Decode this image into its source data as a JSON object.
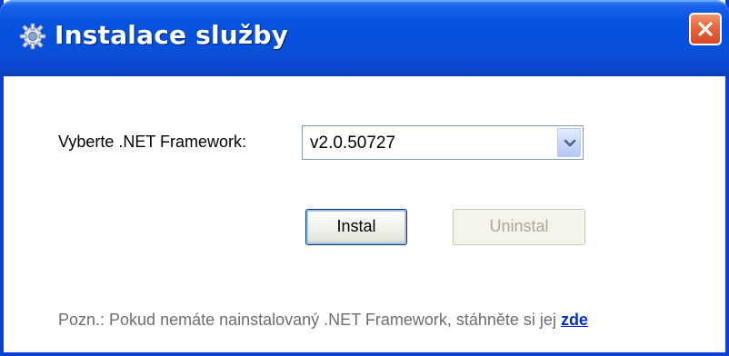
{
  "window": {
    "title": "Instalace služby",
    "title_icon": "gear-icon",
    "close_icon": "close-icon"
  },
  "form": {
    "framework_label": "Vyberte .NET Framework:",
    "framework_selected": "v2.0.50727",
    "dropdown_icon": "chevron-down-icon"
  },
  "buttons": {
    "install_label": "Instal",
    "uninstall_label": "Uninstal",
    "uninstall_disabled": true
  },
  "note": {
    "text": "Pozn.: Pokud nemáte nainstalovaný .NET Framework, stáhněte si jej ",
    "link_text": "zde"
  },
  "colors": {
    "titlebar": "#0552e0",
    "close_button": "#e46d3c",
    "link": "#0033cc",
    "disabled_text": "#aca899"
  }
}
